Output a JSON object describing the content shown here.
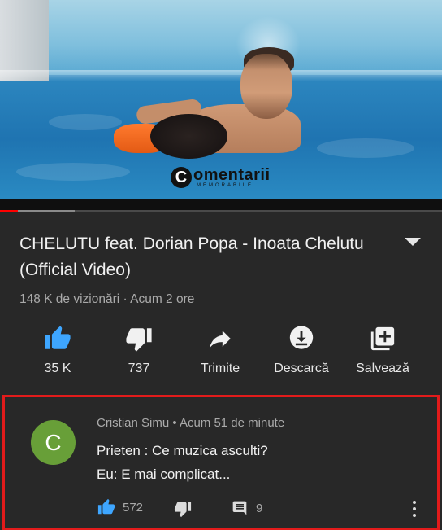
{
  "video": {
    "watermark_main": "omentarii",
    "watermark_letter": "C",
    "watermark_sub": "MEMORABILE",
    "progress_fraction": 0.04,
    "buffer_fraction": 0.17
  },
  "title": "CHELUTU feat. Dorian Popa - Inoata Chelutu (Official Video)",
  "meta": "148 K de vizionări · Acum 2 ore",
  "actions": [
    {
      "icon": "thumbs-up-icon",
      "label": "35 K"
    },
    {
      "icon": "thumbs-down-icon",
      "label": "737"
    },
    {
      "icon": "share-icon",
      "label": "Trimite"
    },
    {
      "icon": "download-icon",
      "label": "Descarcă"
    },
    {
      "icon": "save-playlist-icon",
      "label": "Salvează"
    }
  ],
  "comment": {
    "avatar_letter": "C",
    "author_meta": "Cristian Simu • Acum 51 de minute",
    "line1": "Prieten : Ce muzica asculti?",
    "line2": "Eu: E mai complicat...",
    "likes": "572",
    "replies": "9"
  },
  "colors": {
    "background": "#282828",
    "like_active": "#3ea6ff",
    "highlight_border": "#e21b1b",
    "avatar": "#689f38",
    "progress": "#ff0000"
  }
}
